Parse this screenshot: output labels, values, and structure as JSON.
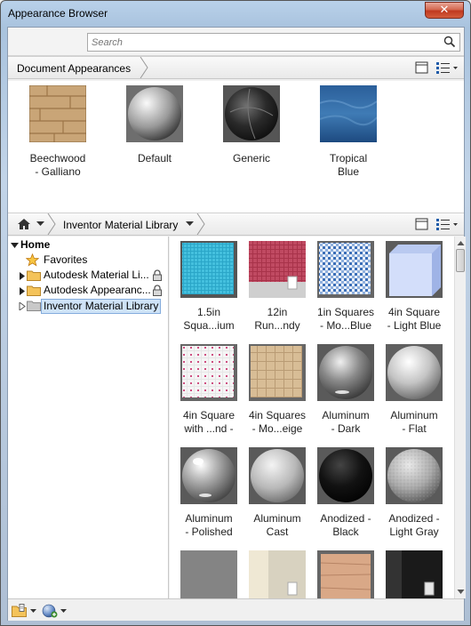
{
  "window": {
    "title": "Appearance Browser",
    "close_label": "✕"
  },
  "search": {
    "placeholder": "Search",
    "value": ""
  },
  "document_section": {
    "label": "Document Appearances",
    "items": [
      {
        "line1": "Beechwood",
        "line2": "- Galliano",
        "icon": "wood-cube-thumb"
      },
      {
        "line1": "Default",
        "line2": "",
        "icon": "grey-sphere-thumb"
      },
      {
        "line1": "Generic",
        "line2": "",
        "icon": "dark-sphere-thumb"
      },
      {
        "line1": "Tropical",
        "line2": "Blue",
        "icon": "water-thumb"
      }
    ]
  },
  "library_section": {
    "label": "Inventor Material Library",
    "home_icon": "home-icon"
  },
  "tree": {
    "items": [
      {
        "label": "Home",
        "level": 0,
        "icon": "expand-down-icon"
      },
      {
        "label": "Favorites",
        "level": 1,
        "icon": "star-icon"
      },
      {
        "label": "Autodesk Material Li...",
        "level": 1,
        "icon": "folder-icon",
        "locked": true
      },
      {
        "label": "Autodesk Appearanc...",
        "level": 1,
        "icon": "folder-icon",
        "locked": true
      },
      {
        "label": "Inventor Material Library",
        "level": 1,
        "icon": "folder-icon",
        "selected": true
      }
    ]
  },
  "materials": [
    {
      "line1": "1.5in",
      "line2": "Squa...ium"
    },
    {
      "line1": "12in",
      "line2": "Run...ndy"
    },
    {
      "line1": "1in Squares",
      "line2": "- Mo...Blue"
    },
    {
      "line1": "4in Square",
      "line2": "- Light Blue"
    },
    {
      "line1": "4in Square",
      "line2": "with ...nd -"
    },
    {
      "line1": "4in Squares",
      "line2": "- Mo...eige"
    },
    {
      "line1": "Aluminum",
      "line2": "- Dark"
    },
    {
      "line1": "Aluminum",
      "line2": "- Flat"
    },
    {
      "line1": "Aluminum",
      "line2": "- Polished"
    },
    {
      "line1": "Aluminum",
      "line2": "Cast"
    },
    {
      "line1": "Anodized -",
      "line2": "Black"
    },
    {
      "line1": "Anodized -",
      "line2": "Light Gray"
    },
    {
      "line1": "",
      "line2": ""
    },
    {
      "line1": "",
      "line2": ""
    },
    {
      "line1": "",
      "line2": ""
    },
    {
      "line1": "",
      "line2": ""
    }
  ],
  "colors": {
    "selection": "#cfe3f7",
    "title_gradient": "#b9d1ea",
    "close": "#c0391f"
  }
}
